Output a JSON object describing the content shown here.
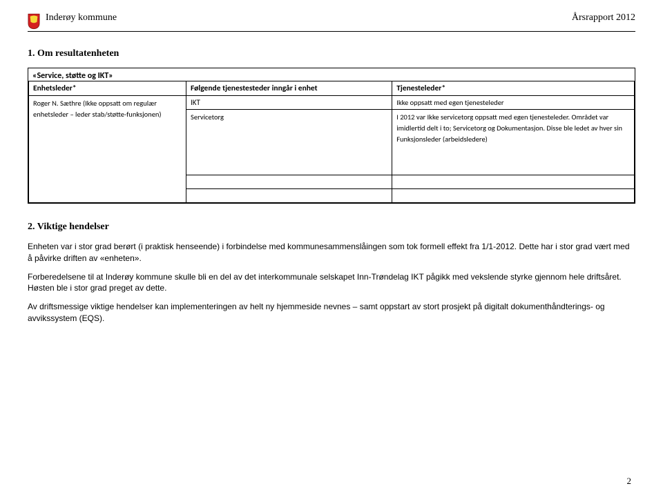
{
  "header": {
    "org": "Inderøy kommune",
    "report": "Årsrapport 2012"
  },
  "section1": {
    "title": "1. Om resultatenheten",
    "quoted": "«Service, støtte og IKT»",
    "col_left_header": "Enhetsleder*",
    "col_mid_header": "Følgende tjenestesteder inngår i enhet",
    "col_right_header": "Tjenesteleder*",
    "left_cell": "Roger N. Sæthre (Ikke oppsatt om regulær enhetsleder – leder stab/støtte-funksjonen)",
    "mid_row1": "IKT",
    "mid_row2": "Servicetorg",
    "right_row1": "Ikke oppsatt med egen tjenesteleder",
    "right_row2": "I 2012 var Ikke servicetorg oppsatt med egen tjenesteleder. Området var imidlertid delt i to; Servicetorg og Dokumentasjon. Disse ble ledet av hver sin Funksjonsleder (arbeidsledere)"
  },
  "section2": {
    "title": "2. Viktige hendelser",
    "p1": "Enheten var i stor grad berørt (i praktisk henseende) i forbindelse med kommunesammenslåingen som tok formell effekt fra 1/1-2012. Dette har i stor grad vært med å påvirke driften av «enheten».",
    "p2": "Forberedelsene til at Inderøy kommune skulle bli en del av det interkommunale selskapet Inn-Trøndelag IKT pågikk med vekslende styrke gjennom hele driftsåret.  Høsten ble i stor grad preget av dette.",
    "p3": "Av driftsmessige viktige hendelser kan implementeringen av helt ny hjemmeside nevnes – samt oppstart av stort prosjekt på digitalt dokumenthåndterings- og avvikssystem (EQS)."
  },
  "page_number": "2"
}
